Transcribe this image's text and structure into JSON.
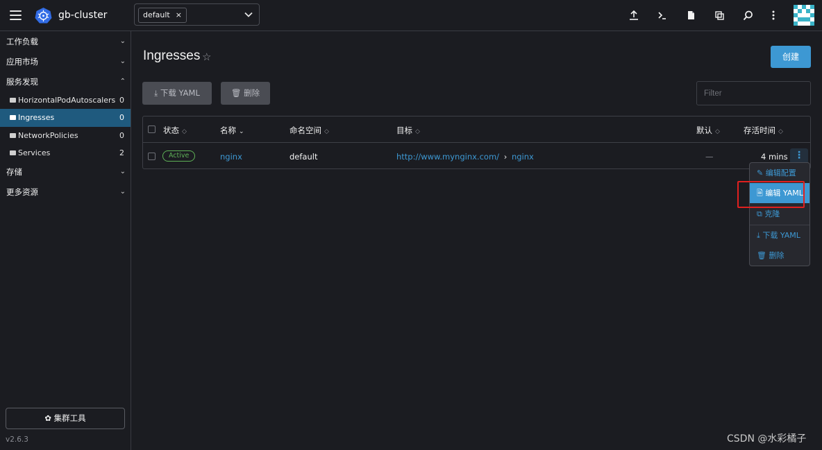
{
  "header": {
    "cluster_name": "gb-cluster",
    "namespace_chip": "default",
    "namespace_chip_remove": "×",
    "icons": [
      "hamburger-icon",
      "kubernetes-logo",
      "chevron-down-icon",
      "upload-icon",
      "terminal-icon",
      "file-icon",
      "copy-icon",
      "search-icon",
      "more-vertical-icon",
      "avatar"
    ]
  },
  "sidebar": {
    "groups": [
      {
        "label": "工作负载",
        "chevron": "⌄"
      },
      {
        "label": "应用市场",
        "chevron": "⌄"
      },
      {
        "label": "服务发现",
        "chevron": "⌃"
      },
      {
        "label": "存储",
        "chevron": "⌄"
      },
      {
        "label": "更多资源",
        "chevron": "⌄"
      }
    ],
    "items": [
      {
        "label": "HorizontalPodAutoscalers",
        "count": "0"
      },
      {
        "label": "Ingresses",
        "count": "0"
      },
      {
        "label": "NetworkPolicies",
        "count": "0"
      },
      {
        "label": "Services",
        "count": "2"
      }
    ],
    "tools_button": "✿ 集群工具",
    "version": "v2.6.3"
  },
  "main": {
    "title": "Ingresses",
    "star": "☆",
    "create_button": "创建",
    "download_yaml_button": "⤓ 下载 YAML",
    "delete_button": "🗑 删除",
    "filter_placeholder": "Filter",
    "table": {
      "columns": [
        "状态",
        "名称",
        "命名空间",
        "目标",
        "默认",
        "存活时间"
      ],
      "sort_icons": [
        "◇",
        "⌄",
        "◇",
        "◇",
        "◇",
        "◇"
      ],
      "rows": [
        {
          "status": "Active",
          "name": "nginx",
          "namespace": "default",
          "target_url": "http://www.mynginx.com/",
          "target_sep": "›",
          "target_service": "nginx",
          "default": "—",
          "age": "4 mins",
          "actions": "⋮"
        }
      ]
    },
    "context_menu": [
      {
        "label": "✎ 编辑配置"
      },
      {
        "label": "🗎 编辑 YAML"
      },
      {
        "label": "⧉ 克隆"
      },
      {
        "label": "⤓ 下载 YAML"
      },
      {
        "label": "🗑 删除"
      }
    ]
  },
  "watermark": "CSDN @水彩橘子",
  "colors": {
    "accent": "#3d98d3",
    "active_nav": "#1f5a7e",
    "status_active": "#5fb257",
    "highlight_box": "#e0201f"
  }
}
